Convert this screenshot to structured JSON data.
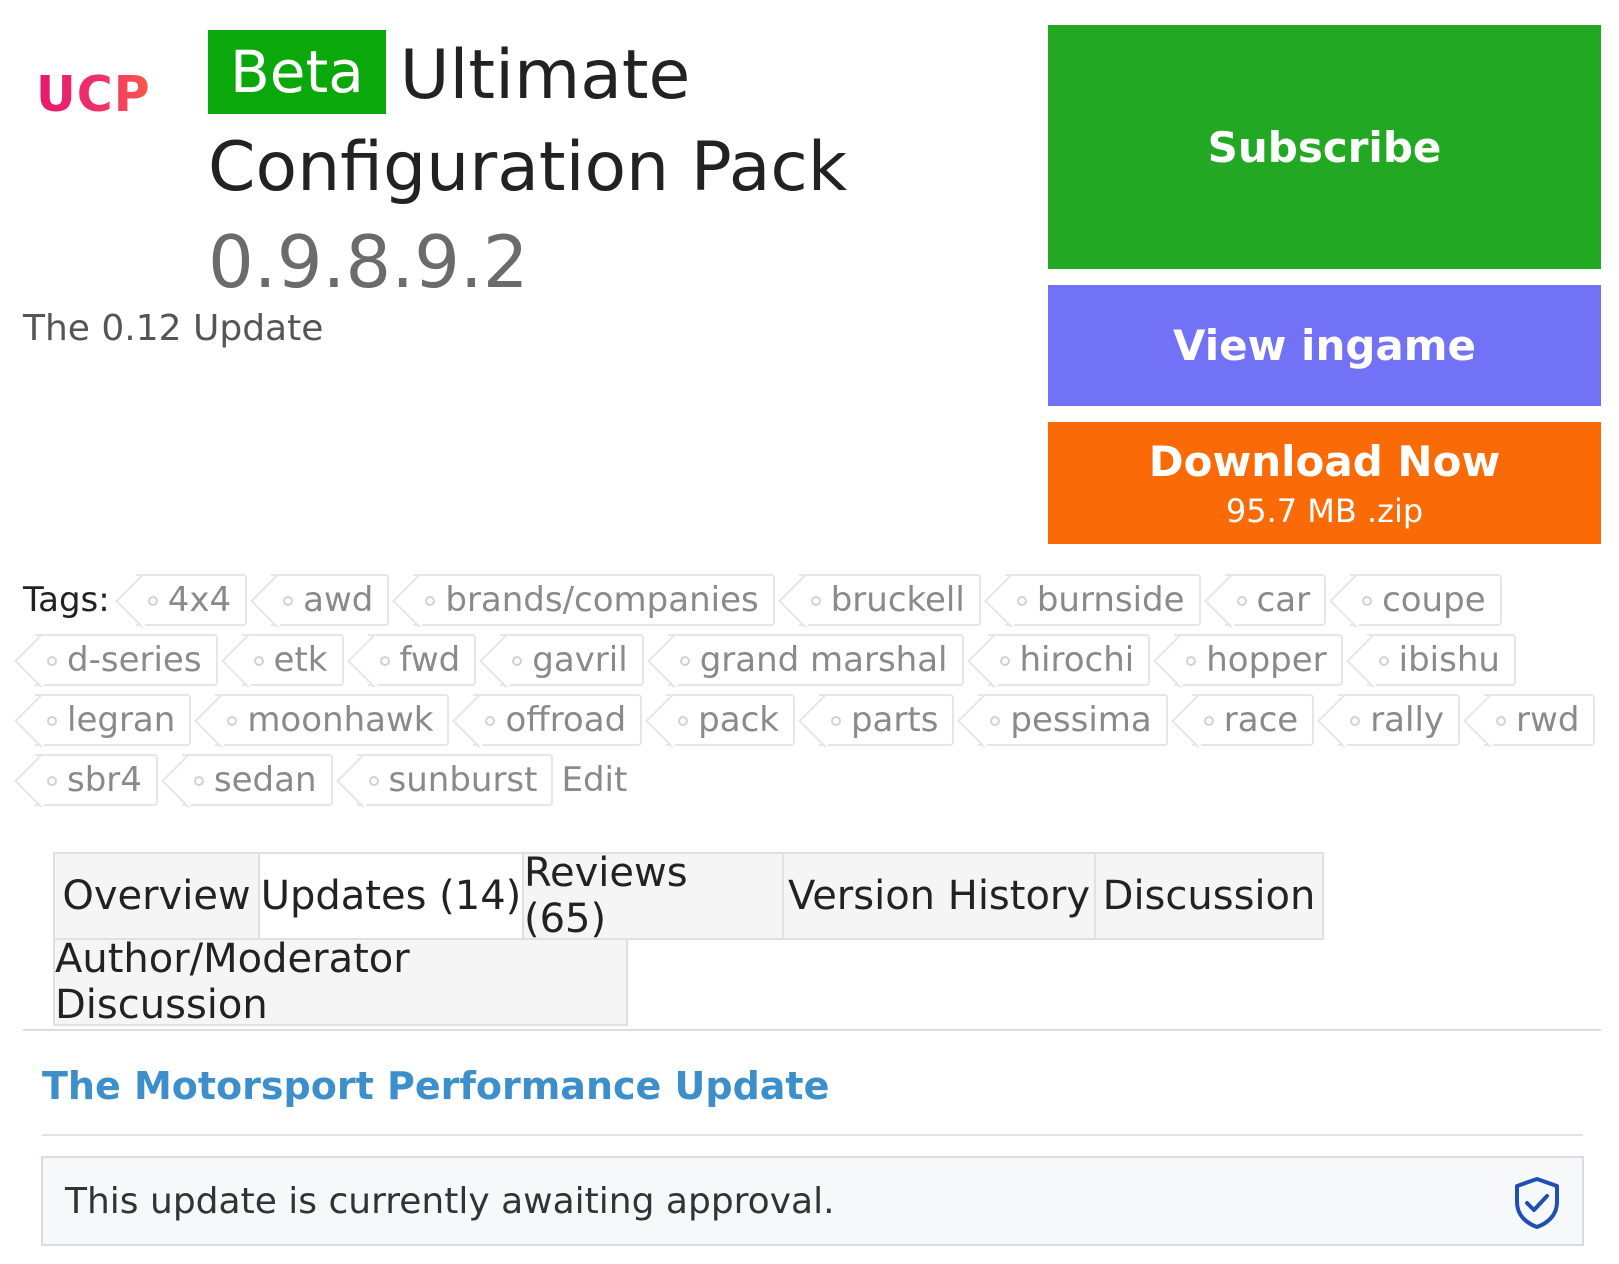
{
  "logo": {
    "text": "UCP"
  },
  "header": {
    "badge": "Beta",
    "title_line1": "Ultimate",
    "title_line2": "Configuration Pack",
    "version": "0.9.8.9.2",
    "tagline": "The 0.12 Update"
  },
  "actions": {
    "subscribe": "Subscribe",
    "view_ingame": "View ingame",
    "download": {
      "label": "Download Now",
      "meta": "95.7 MB .zip"
    }
  },
  "tags": {
    "label": "Tags:",
    "items": [
      "4x4",
      "awd",
      "brands/companies",
      "bruckell",
      "burnside",
      "car",
      "coupe",
      "d-series",
      "etk",
      "fwd",
      "gavril",
      "grand marshal",
      "hirochi",
      "hopper",
      "ibishu",
      "legran",
      "moonhawk",
      "offroad",
      "pack",
      "parts",
      "pessima",
      "race",
      "rally",
      "rwd",
      "sbr4",
      "sedan",
      "sunburst"
    ],
    "edit": "Edit"
  },
  "tabs": {
    "row1": [
      "Overview",
      "Updates (14)",
      "Reviews (65)",
      "Version History",
      "Discussion"
    ],
    "row2": [
      "Author/Moderator Discussion"
    ],
    "active": "Updates (14)"
  },
  "update": {
    "title": "The Motorsport Performance Update",
    "notice": "This update is currently awaiting approval.",
    "notice_icon": "shield-check-icon"
  },
  "colors": {
    "beta_badge": "#0ba80b",
    "subscribe": "#23a823",
    "view_ingame": "#7172f6",
    "download": "#fa6a06",
    "link": "#3d8fcc"
  }
}
